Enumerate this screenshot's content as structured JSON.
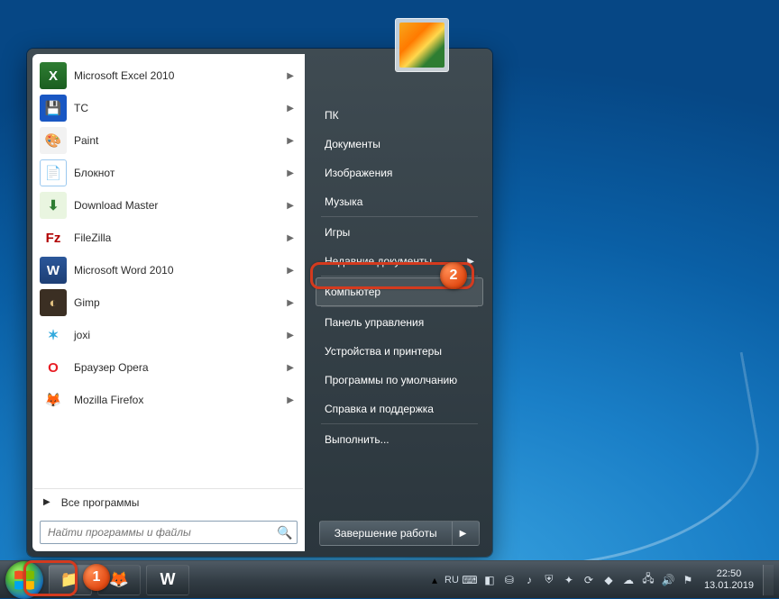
{
  "programs": [
    {
      "label": "Microsoft Excel 2010",
      "icon": "excel-icon",
      "glyph": "X",
      "cls": "i-excel",
      "fg": "#fff",
      "arrow": true
    },
    {
      "label": "TC",
      "icon": "tc-icon",
      "glyph": "💾",
      "cls": "i-tc",
      "fg": "#fff",
      "arrow": true
    },
    {
      "label": "Paint",
      "icon": "paint-icon",
      "glyph": "🎨",
      "cls": "i-paint",
      "fg": "#000",
      "arrow": true
    },
    {
      "label": "Блокнот",
      "icon": "notepad-icon",
      "glyph": "📄",
      "cls": "i-notepad",
      "fg": "#000",
      "arrow": true
    },
    {
      "label": "Download Master",
      "icon": "download-master-icon",
      "glyph": "⬇",
      "cls": "i-dm",
      "fg": "#2e7d32",
      "arrow": true
    },
    {
      "label": "FileZilla",
      "icon": "filezilla-icon",
      "glyph": "Fz",
      "cls": "i-fz",
      "fg": "#b10000",
      "arrow": true
    },
    {
      "label": "Microsoft Word 2010",
      "icon": "word-icon",
      "glyph": "W",
      "cls": "i-word",
      "fg": "#fff",
      "arrow": true
    },
    {
      "label": "Gimp",
      "icon": "gimp-icon",
      "glyph": "◐",
      "cls": "i-gimp",
      "fg": "#e0c080",
      "arrow": true
    },
    {
      "label": "joxi",
      "icon": "joxi-icon",
      "glyph": "✶",
      "cls": "i-joxi",
      "fg": "#33aadd",
      "arrow": true
    },
    {
      "label": "Браузер Opera",
      "icon": "opera-icon",
      "glyph": "O",
      "cls": "i-opera",
      "fg": "#e81c23",
      "arrow": true
    },
    {
      "label": "Mozilla Firefox",
      "icon": "firefox-icon",
      "glyph": "🦊",
      "cls": "i-ff",
      "fg": "#ff7139",
      "arrow": true
    }
  ],
  "all_programs_label": "Все программы",
  "search": {
    "placeholder": "Найти программы и файлы"
  },
  "right_items": [
    {
      "label": "ПК",
      "sep": false
    },
    {
      "label": "Документы",
      "sep": false
    },
    {
      "label": "Изображения",
      "sep": false
    },
    {
      "label": "Музыка",
      "sep": true
    },
    {
      "label": "Игры",
      "sep": false
    },
    {
      "label": "Недавние документы",
      "arrow": true,
      "sep": true
    },
    {
      "label": "Компьютер",
      "selected": true,
      "sep": true
    },
    {
      "label": "Панель управления",
      "sep": false
    },
    {
      "label": "Устройства и принтеры",
      "sep": false
    },
    {
      "label": "Программы по умолчанию",
      "sep": false
    },
    {
      "label": "Справка и поддержка",
      "sep": true
    },
    {
      "label": "Выполнить...",
      "sep": false
    }
  ],
  "shutdown": {
    "label": "Завершение работы"
  },
  "taskbar": {
    "pinned": [
      {
        "name": "explorer",
        "glyph": "📁",
        "active": true
      },
      {
        "name": "firefox",
        "glyph": "🦊",
        "active": false
      },
      {
        "name": "word",
        "glyph": "W",
        "active": false
      }
    ],
    "lang": "RU",
    "tray_icons": [
      "keyboard-icon",
      "app1-icon",
      "drive-icon",
      "audio-icon",
      "shield-icon",
      "tool-icon",
      "update-icon",
      "app2-icon",
      "cloud-icon",
      "network-icon",
      "volume-icon",
      "flag-icon"
    ],
    "time": "22:50",
    "date": "13.01.2019"
  },
  "callout_badges": {
    "start": "1",
    "computer": "2"
  }
}
